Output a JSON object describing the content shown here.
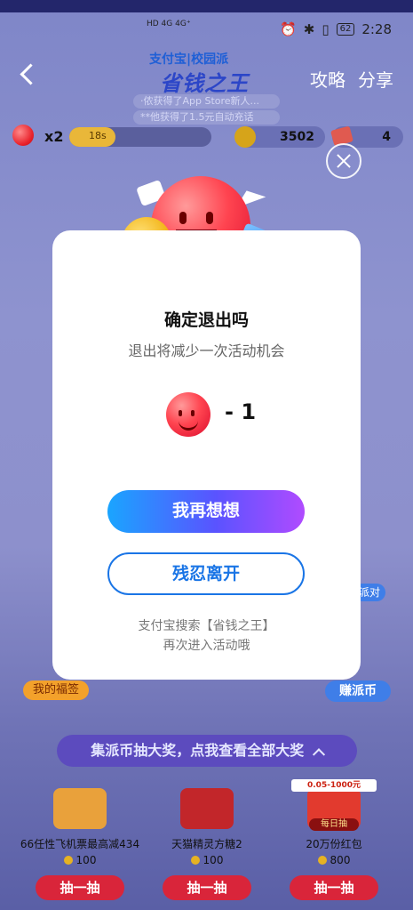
{
  "status_bar": {
    "network_left": "HD 4G 4G⁺",
    "battery": "62",
    "time": "2:28"
  },
  "navbar": {
    "brand_top": "支付宝|校园派",
    "title": "省钱之王",
    "actions": [
      "攻略",
      "分享"
    ]
  },
  "ticker": {
    "lines": [
      "·侬获得了App Store新人...",
      "**他获得了1.5元自动充话"
    ]
  },
  "resources": {
    "lives_label": "x2",
    "timer_text": "18s",
    "coins": "3502",
    "tickets": "4"
  },
  "modal": {
    "title": "确定退出吗",
    "subtitle": "退出将减少一次活动机会",
    "cost_text": "- 1",
    "primary_button": "我再想想",
    "secondary_button": "残忍离开",
    "footer_line1": "支付宝搜索【省钱之王】",
    "footer_line2": "再次进入活动哦"
  },
  "side_badges": {
    "left": "我的福签",
    "right": "赚派币",
    "right_small": "派对"
  },
  "prize_section": {
    "header": "集派币抽大奖，点我查看全部大奖",
    "cards": [
      {
        "name": "66任性飞机票最高减434",
        "cost": "100",
        "draw": "抽一抽"
      },
      {
        "name": "天猫精灵方糖2",
        "cost": "100",
        "draw": "抽一抽"
      },
      {
        "name": "20万份红包",
        "cost": "800",
        "draw": "抽一抽",
        "tag": "0.05-1000元",
        "daily": "每日抽"
      }
    ]
  },
  "colors": {
    "primary_gradient_start": "#1aa5ff",
    "primary_gradient_end": "#b04bff",
    "secondary_border": "#1a75e6",
    "draw_button": "#d9253a"
  }
}
